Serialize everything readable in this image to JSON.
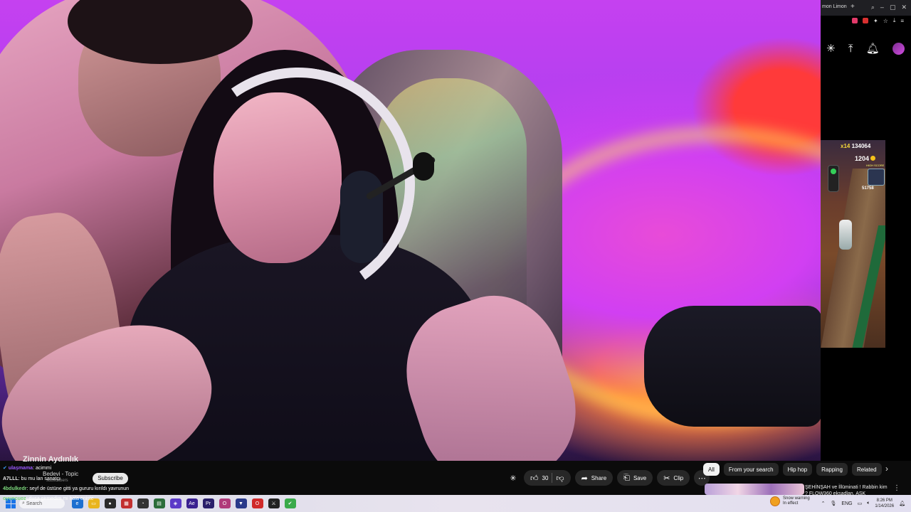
{
  "stream": {
    "tab_title": "mon Limon",
    "game": {
      "multiplier": "x14",
      "score": "134064",
      "coins": "1204",
      "high_score_label": "HIGH SCORE",
      "high_score": "51758"
    }
  },
  "chat": {
    "channel_name": "Zinnin Aydınlık",
    "messages": [
      {
        "user": "ulaşmama",
        "text": "acimmi",
        "user_color": "#9b59ff"
      },
      {
        "user": "A7LLL",
        "text": "bu mu lan sanatçı",
        "user_color": "#e9e9e9"
      },
      {
        "user": "4bdulkedr",
        "text": "seyf de üstüne gitti ya gururu kırıldı yavrunun",
        "user_color": "#7cd87c"
      },
      {
        "user": "oyuncuoz",
        "text": "duşa girmedim mi hala enişte",
        "user_color": "#7cd87c"
      }
    ]
  },
  "song": {
    "title": "Bedevi - Topic",
    "subtitle": "subscribers",
    "subscribe_label": "Subscribe"
  },
  "actions": {
    "like_count": "30",
    "share_label": "Share",
    "save_label": "Save",
    "clip_label": "Clip"
  },
  "chips": [
    "All",
    "From your search",
    "Hip hop",
    "Rapping",
    "Related"
  ],
  "recommendation": {
    "title": "ŞEHİNŞAH ve İllüminati ! Rabbin kim ? FLOW360 ekşadlan. AŞK"
  },
  "taskbar": {
    "search_placeholder": "Search",
    "weather_title": "Snow warning",
    "weather_sub": "In effect",
    "language": "ENG",
    "time": "8:26 PM",
    "date": "1/14/2026"
  },
  "colors": {
    "yt_pill": "#272727",
    "chip_active": "#f1f1f1",
    "win_accent": "#1a73e8"
  }
}
